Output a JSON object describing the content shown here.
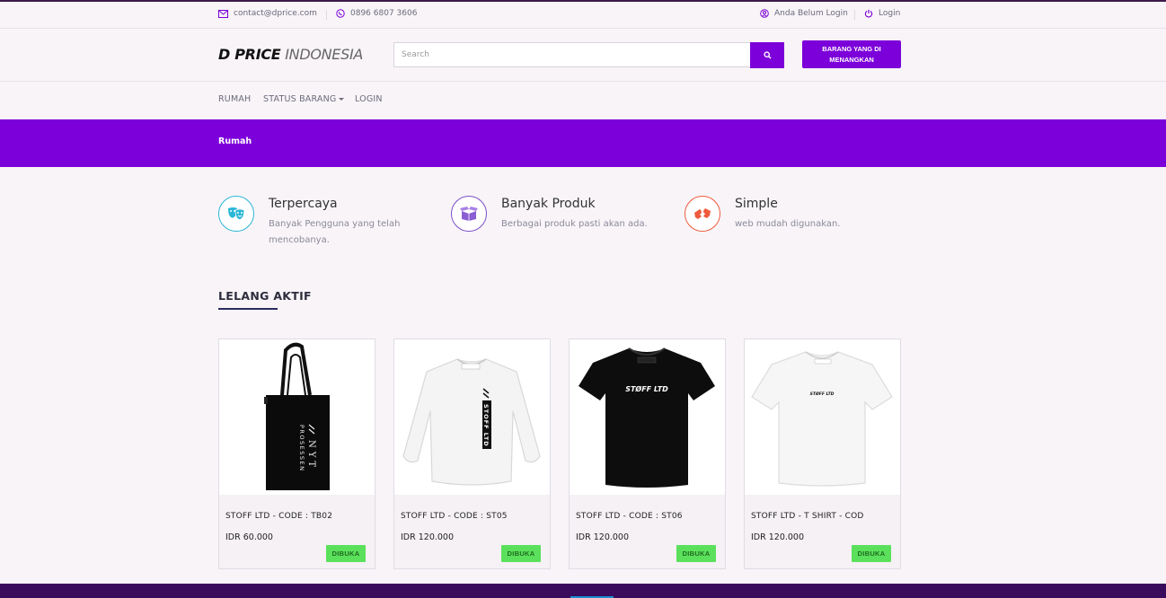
{
  "topbar": {
    "email": "contact@dprice.com",
    "phone": "0896 6807 3606",
    "login_status": "Anda Belum Login",
    "login_label": "Login"
  },
  "header": {
    "logo_bold": "D PRICE",
    "logo_light": "INDONESIA",
    "search_placeholder": "Search",
    "won_items_button": "BARANG YANG DI MENANGKAN"
  },
  "nav": {
    "items": [
      {
        "label": "RUMAH"
      },
      {
        "label": "STATUS BARANG"
      },
      {
        "label": "LOGIN"
      }
    ]
  },
  "breadcrumb": {
    "current": "Rumah"
  },
  "features": [
    {
      "title": "Terpercaya",
      "desc": "Banyak Pengguna yang telah mencobanya.",
      "icon": "masks-icon",
      "color": "#2bb7d6"
    },
    {
      "title": "Banyak Produk",
      "desc": "Berbagai produk pasti akan ada.",
      "icon": "box-icon",
      "color": "#7b4fc8"
    },
    {
      "title": "Simple",
      "desc": "web mudah digunakan.",
      "icon": "hands-icon",
      "color": "#ee5a3c"
    }
  ],
  "section": {
    "title": "LELANG AKTIF"
  },
  "products": [
    {
      "name": "STOFF LTD - CODE : TB02",
      "price": "IDR 60.000",
      "status": "DIBUKA",
      "image": "tote-bag"
    },
    {
      "name": "STOFF LTD - CODE : ST05",
      "price": "IDR 120.000",
      "status": "DIBUKA",
      "image": "white-longsleeve"
    },
    {
      "name": "STOFF LTD - CODE : ST06",
      "price": "IDR 120.000",
      "status": "DIBUKA",
      "image": "black-tshirt"
    },
    {
      "name": "STOFF LTD - T SHIRT - COD",
      "price": "IDR 120.000",
      "status": "DIBUKA",
      "image": "white-tshirt"
    }
  ],
  "product_art": {
    "tote_text": "PROSESSEN",
    "tote_text2": "NYT",
    "longsleeve_text": "STOFF LTD",
    "tshirt_text": "STØFF LTD"
  },
  "colors": {
    "accent": "#7c00d9",
    "badge": "#5be05b",
    "footer": "#3a0a5c"
  }
}
